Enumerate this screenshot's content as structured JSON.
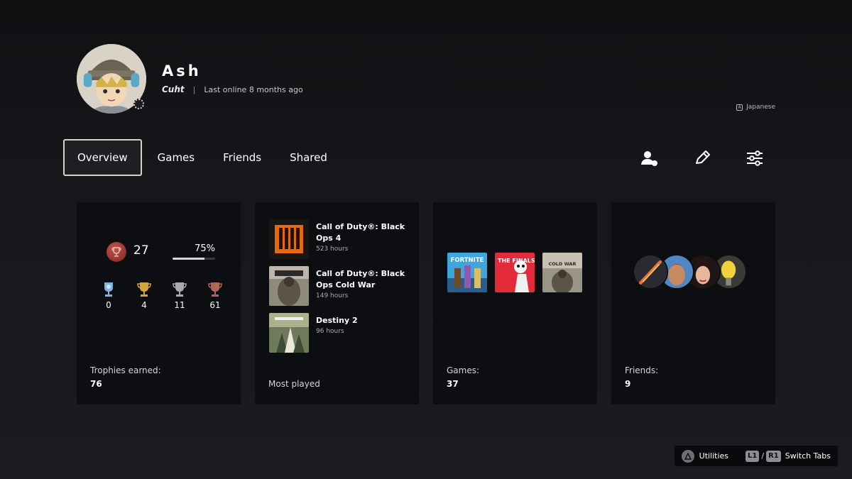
{
  "profile": {
    "name": "Ash",
    "nickname": "Cuht",
    "separator": "|",
    "last_online": "Last online 8 months ago",
    "language": "Japanese"
  },
  "tabs": [
    {
      "label": "Overview",
      "active": true
    },
    {
      "label": "Games",
      "active": false
    },
    {
      "label": "Friends",
      "active": false
    },
    {
      "label": "Shared",
      "active": false
    }
  ],
  "toolbar": {
    "icons": [
      "add-friend-icon",
      "edit-pencil-icon",
      "settings-sliders-icon"
    ]
  },
  "trophies": {
    "level": "27",
    "progress_text": "75%",
    "progress": 0.75,
    "platinum": "0",
    "gold": "4",
    "silver": "11",
    "bronze": "61",
    "label": "Trophies earned:",
    "total": "76"
  },
  "most_played": {
    "label": "Most played",
    "games": [
      {
        "title": "Call of Duty®: Black Ops 4",
        "hours": "523 hours"
      },
      {
        "title": "Call of Duty®: Black Ops Cold War",
        "hours": "149 hours"
      },
      {
        "title": "Destiny 2",
        "hours": "96 hours"
      }
    ]
  },
  "games": {
    "label": "Games:",
    "count": "37",
    "covers": [
      "FORTNITE",
      "THE FINALS",
      "COLD WAR"
    ]
  },
  "friends": {
    "label": "Friends:",
    "count": "9"
  },
  "hints": {
    "utilities": "Utilities",
    "l1": "L1",
    "slash": "/",
    "r1": "R1",
    "switch_tabs": "Switch Tabs"
  },
  "colors": {
    "background": "#17181b",
    "card": "#0d0e11",
    "active_tab_border": "#d9d2c4",
    "level_badge": "#a8362f"
  }
}
